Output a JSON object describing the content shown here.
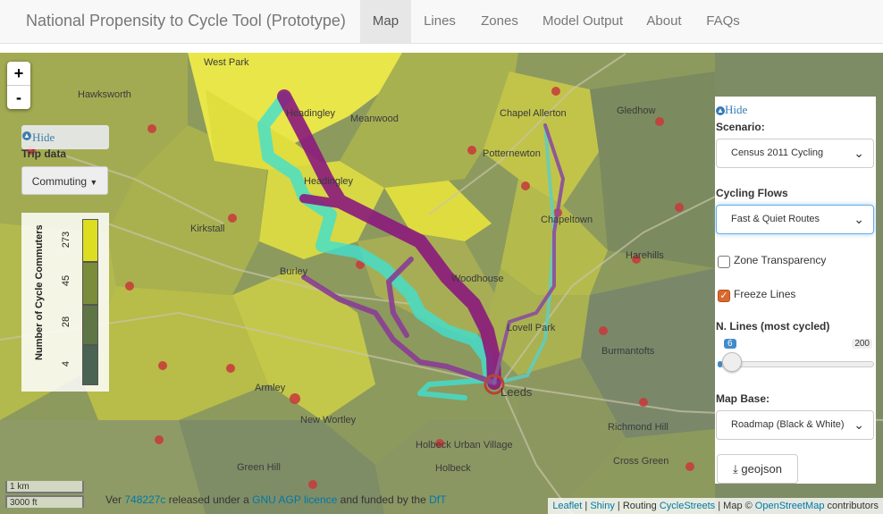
{
  "navbar": {
    "brand": "National Propensity to Cycle Tool (Prototype)",
    "items": [
      "Map",
      "Lines",
      "Zones",
      "Model Output",
      "About",
      "FAQs"
    ],
    "active": "Map"
  },
  "zoom": {
    "in": "+",
    "out": "-"
  },
  "left_panel": {
    "hide": "Hide",
    "trip_data_label": "Trip data",
    "trip_select": "Commuting"
  },
  "legend": {
    "title": "Number of Cycle Commuters",
    "ticks": [
      "273",
      "45",
      "28",
      "4"
    ],
    "colors": [
      "#dddd22",
      "#7b8c3b",
      "#5e7546",
      "#4a6352"
    ]
  },
  "scale": {
    "metric": "1 km",
    "imperial": "3000 ft"
  },
  "places": [
    "West Park",
    "Hawksworth",
    "Headingley",
    "Meanwood",
    "Chapel Allerton",
    "Potternewton",
    "Chapeltown",
    "Kirkstall",
    "Headingley",
    "Harehills",
    "Burley",
    "Woodhouse",
    "Lovell Park",
    "Burmantofts",
    "Armley",
    "Leeds",
    "New Wortley",
    "Holbeck Urban Village",
    "Holbeck",
    "Green Hill",
    "Cross Green",
    "Richmond Hill",
    "Gledhow"
  ],
  "version": {
    "prefix": "Ver",
    "commit": "748227c",
    "middle": "released under a",
    "licence": "GNU AGP licence",
    "suffix": "and funded by the",
    "funder": "DfT"
  },
  "attribution": {
    "leaflet": "Leaflet",
    "shiny": "Shiny",
    "routing_prefix": "Routing",
    "cyclestreets": "CycleStreets",
    "map_prefix": "Map ©",
    "osm": "OpenStreetMap",
    "osm_suffix": "contributors"
  },
  "right_panel": {
    "hide": "Hide",
    "scenario_label": "Scenario:",
    "scenario_value": "Census 2011 Cycling",
    "flows_label": "Cycling Flows",
    "flows_value": "Fast & Quiet Routes",
    "zone_transparency": "Zone Transparency",
    "zone_transparency_checked": false,
    "freeze_lines": "Freeze Lines",
    "freeze_lines_checked": true,
    "nlines_label": "N. Lines (most cycled)",
    "nlines_value": "6",
    "nlines_max": "200",
    "nlines_fraction": 0.03,
    "mapbase_label": "Map Base:",
    "mapbase_value": "Roadmap (Black & White)",
    "geojson": "geojson"
  },
  "colors": {
    "fast_route": "#8b1a7d",
    "quiet_route": "#40e0d0",
    "accent": "#428bca"
  }
}
